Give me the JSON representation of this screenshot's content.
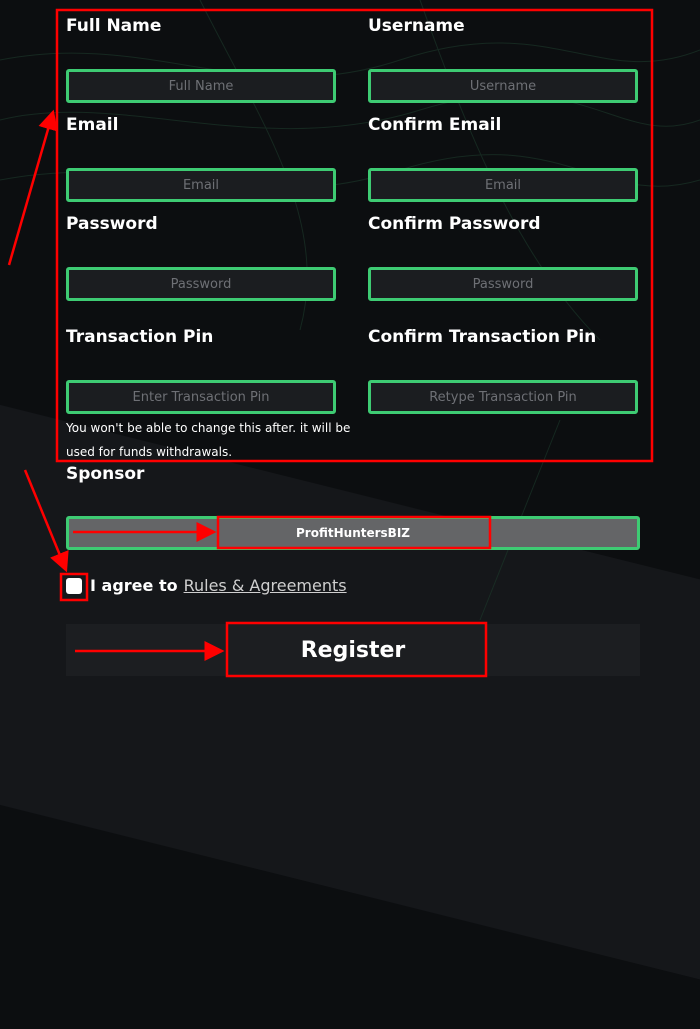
{
  "form": {
    "full_name": {
      "label": "Full Name",
      "placeholder": "Full Name"
    },
    "username": {
      "label": "Username",
      "placeholder": "Username"
    },
    "email": {
      "label": "Email",
      "placeholder": "Email"
    },
    "confirm_email": {
      "label": "Confirm Email",
      "placeholder": "Email"
    },
    "password": {
      "label": "Password",
      "placeholder": "Password"
    },
    "confirm_password": {
      "label": "Confirm Password",
      "placeholder": "Password"
    },
    "transaction_pin": {
      "label": "Transaction Pin",
      "placeholder": "Enter Transaction Pin"
    },
    "confirm_transaction_pin": {
      "label": "Confirm Transaction Pin",
      "placeholder": "Retype Transaction Pin"
    },
    "pin_note": "You won't be able to change this after. it will be used for funds withdrawals.",
    "sponsor": {
      "label": "Sponsor",
      "value": "ProfitHuntersBIZ"
    },
    "agree": {
      "prefix": "I agree to",
      "link": "Rules & Agreements",
      "checked": false
    },
    "register_label": "Register"
  },
  "colors": {
    "accent_green": "#3ecb73",
    "annotation_red": "#ff0000",
    "background": "#0c0e10"
  }
}
